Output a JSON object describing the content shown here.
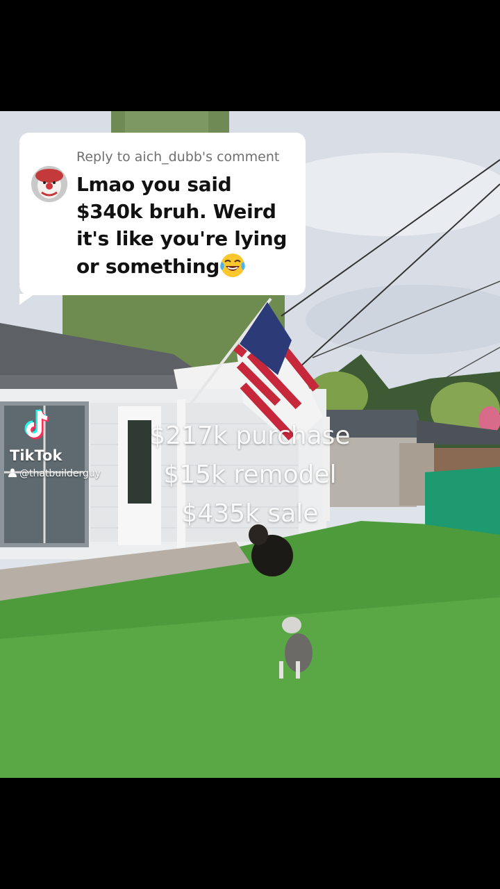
{
  "reply": {
    "header": "Reply to aich_dubb's comment",
    "line1": "Lmao you said",
    "line2": "$340k bruh. Weird",
    "line3": "it's like you're lying",
    "line4": "or something",
    "emoji": "face-with-tears-of-joy-emoji"
  },
  "watermark": {
    "brand": "TikTok",
    "username": "@thatbuilderguy",
    "logo_icon": "tiktok-logo-icon",
    "user_icon": "user-icon"
  },
  "overlay": {
    "purchase": "$217k purchase",
    "remodel": "$15k remodel",
    "sale": "$435k sale"
  },
  "colors": {
    "background": "#000000",
    "card": "#ffffff",
    "tiktok_cyan": "#25f4ee",
    "tiktok_red": "#fe2c55"
  }
}
